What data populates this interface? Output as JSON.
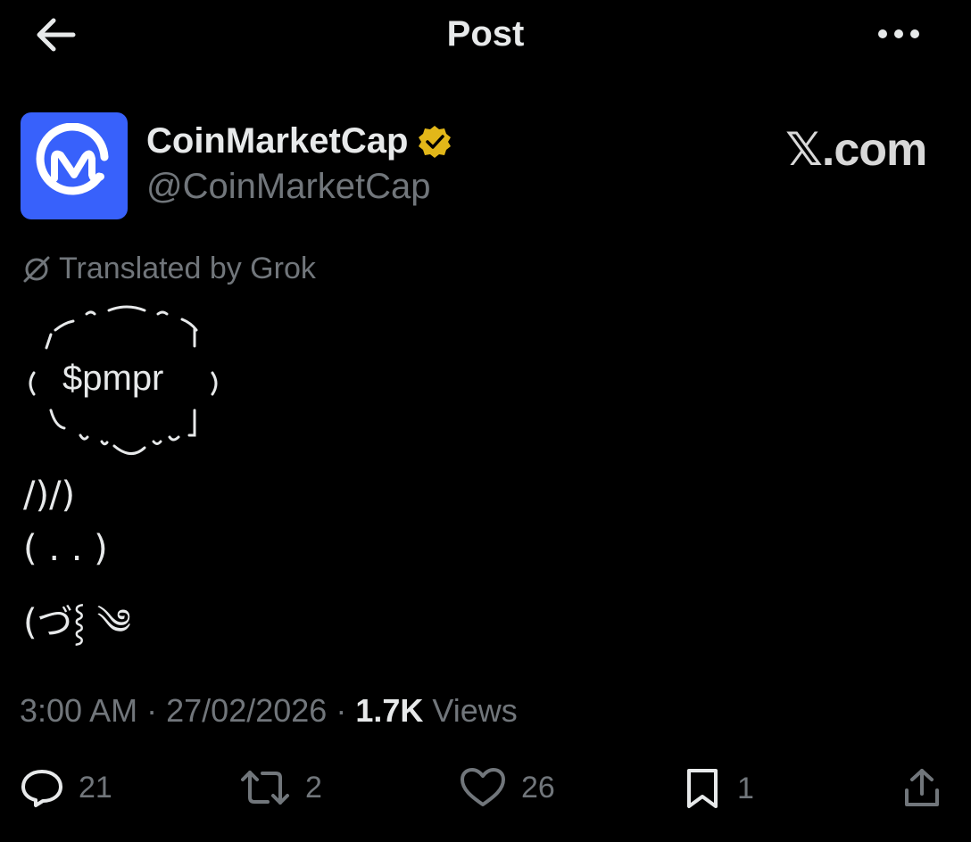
{
  "header": {
    "title": "Post",
    "back_icon": "arrow-left-icon",
    "more_icon": "more-horizontal-icon"
  },
  "author": {
    "name": "CoinMarketCap",
    "handle": "@CoinMarketCap",
    "verified_badge": "gold-verified-badge-icon",
    "avatar_color": "#3861fb"
  },
  "watermark": "𝕏.com",
  "translation": {
    "label": "Translated by Grok",
    "icon": "translate-off-icon"
  },
  "post": {
    "ticker": "$pmpr",
    "kaomoji_lines": [
      "/)/)",
      "( . . )",
      "(づ⸾ ༄"
    ]
  },
  "meta": {
    "time": "3:00 AM",
    "date": "27/02/2026",
    "views_count": "1.7K",
    "views_label": "Views",
    "separator": "·"
  },
  "actions": {
    "reply_count": "21",
    "repost_count": "2",
    "like_count": "26",
    "bookmark_count": "1"
  },
  "colors": {
    "background": "#000000",
    "text_primary": "#e7e9ea",
    "text_secondary": "#71767b",
    "verified_gold": "#e2b719"
  }
}
